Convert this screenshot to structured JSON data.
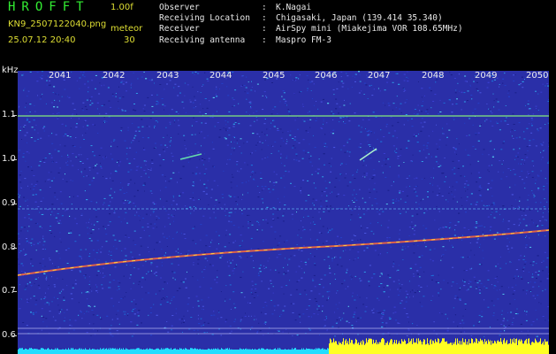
{
  "header": {
    "title": "HROFFT",
    "version": "1.00f",
    "filename": "KN9_2507122040.png",
    "meteor_label": "meteor",
    "datetime": "25.07.12 20:40",
    "count": "30"
  },
  "info": [
    {
      "key": "Observer",
      "value": "K.Nagai"
    },
    {
      "key": "Receiving Location",
      "value": "Chigasaki, Japan (139.414 35.340)"
    },
    {
      "key": "Receiver",
      "value": "AirSpy mini (Miakejima VOR 108.65MHz)"
    },
    {
      "key": "Receiving antenna",
      "value": "Maspro FM-3"
    }
  ],
  "axis": {
    "unit": "kHz",
    "years": [
      "2041",
      "2042",
      "2043",
      "2044",
      "2045",
      "2046",
      "2047",
      "2048",
      "2049",
      "2050"
    ],
    "freq_labels": [
      "1.1",
      "1.0",
      "0.9",
      "0.8",
      "0.7",
      "0.6"
    ]
  },
  "colors": {
    "background": "#2a2fa8",
    "header_green": "#33ee33",
    "header_yellow": "#dddd33",
    "noise_yellow": "#ffff22",
    "noise_cyan": "#22ddff"
  }
}
